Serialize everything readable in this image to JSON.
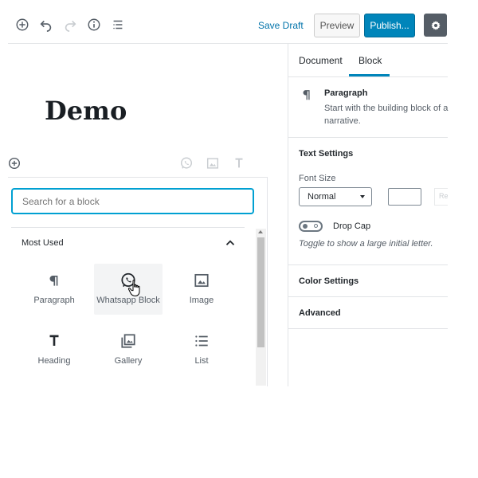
{
  "toolbar": {
    "save_draft": "Save Draft",
    "preview": "Preview",
    "publish": "Publish..."
  },
  "editor": {
    "title": "Demo"
  },
  "sidebar": {
    "tabs": [
      "Document",
      "Block"
    ],
    "block": {
      "name": "Paragraph",
      "description_line1": "Start with the building block of a",
      "description_line2": "narrative."
    },
    "text_settings": {
      "heading": "Text Settings",
      "font_size_label": "Font Size",
      "font_size_value": "Normal",
      "custom_size_value": "",
      "reset_label": "Reset",
      "drop_cap_label": "Drop Cap",
      "drop_cap_help": "Toggle to show a large initial letter."
    },
    "color_settings": "Color Settings",
    "advanced": "Advanced"
  },
  "inserter": {
    "search_placeholder": "Search for a block",
    "panel_title": "Most Used",
    "blocks": [
      {
        "label": "Paragraph",
        "icon": "paragraph-icon"
      },
      {
        "label": "Whatsapp Block",
        "icon": "whatsapp-icon"
      },
      {
        "label": "Image",
        "icon": "image-icon"
      },
      {
        "label": "Heading",
        "icon": "heading-icon"
      },
      {
        "label": "Gallery",
        "icon": "gallery-icon"
      },
      {
        "label": "List",
        "icon": "list-icon"
      }
    ]
  },
  "colors": {
    "accent": "#0085ba",
    "link": "#0073aa",
    "focus": "#00a0d2"
  }
}
